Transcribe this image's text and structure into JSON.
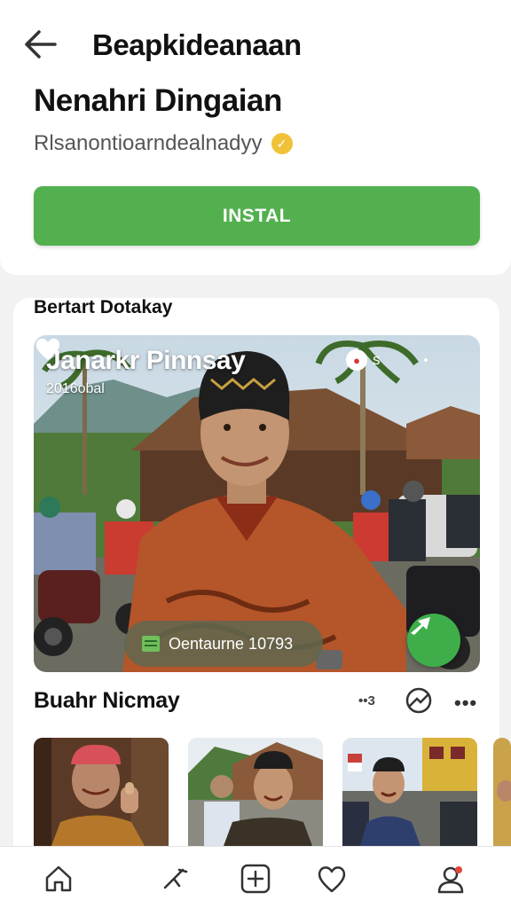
{
  "header": {
    "title": "Beapkideanaan"
  },
  "profile": {
    "name": "Nenahri Dingaian",
    "subtitle": "Rlsanontioarndealnadyy",
    "install_label": "INSTAL"
  },
  "featured": {
    "section_title": "Bertart Dotakay",
    "card_title": "Janarkr Pinnsay",
    "card_date": "2016obal",
    "badge_text": "s",
    "pill_label": "Oentaurne  10793"
  },
  "popular": {
    "section_title": "Buahr Nicmay",
    "count_label": "••3",
    "more_label": "•••"
  },
  "nav": {
    "items": [
      "home-icon",
      "activity-icon",
      "add-icon",
      "heart-icon",
      "profile-icon"
    ]
  },
  "colors": {
    "accent_green": "#53b04f",
    "fab_green": "#3fae4a",
    "verify_gold": "#f0c23a",
    "notify_red": "#e0443a"
  }
}
